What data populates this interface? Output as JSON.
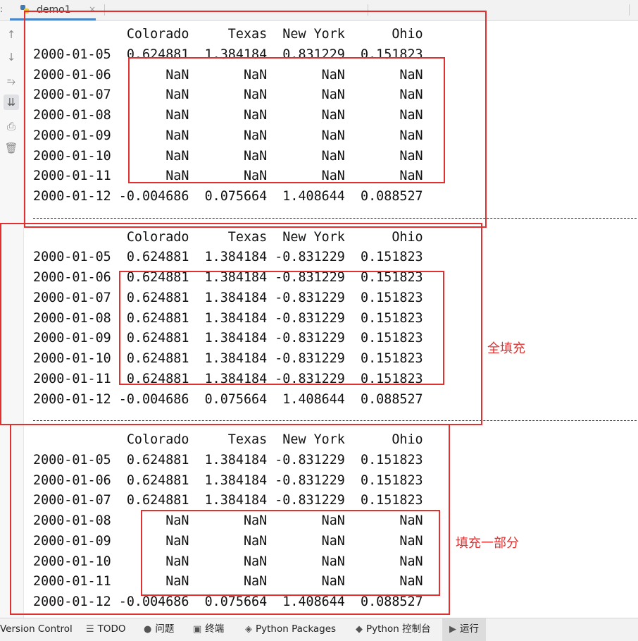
{
  "tab": {
    "file_name": "demo1",
    "close_glyph": "×"
  },
  "left_edge_glyph": ":",
  "gutter_icons": [
    "arrow-up-icon",
    "arrow-down-icon",
    "soft-wrap-icon",
    "scroll-to-end-icon",
    "print-icon",
    "trash-icon"
  ],
  "gutter_glyphs": [
    "↑",
    "↓",
    "⥱",
    "⇊",
    "⎙",
    "🗑"
  ],
  "blocks": [
    {
      "header": "            Colorado     Texas  New York      Ohio",
      "rows": [
        "2000-01-05  0.624881  1.384184  0.831229  0.151823",
        "2000-01-06       NaN       NaN       NaN       NaN",
        "2000-01-07       NaN       NaN       NaN       NaN",
        "2000-01-08       NaN       NaN       NaN       NaN",
        "2000-01-09       NaN       NaN       NaN       NaN",
        "2000-01-10       NaN       NaN       NaN       NaN",
        "2000-01-11       NaN       NaN       NaN       NaN",
        "2000-01-12 -0.004686  0.075664  1.408644  0.088527"
      ]
    },
    {
      "header": "            Colorado     Texas  New York      Ohio",
      "rows": [
        "2000-01-05  0.624881  1.384184 -0.831229  0.151823",
        "2000-01-06  0.624881  1.384184 -0.831229  0.151823",
        "2000-01-07  0.624881  1.384184 -0.831229  0.151823",
        "2000-01-08  0.624881  1.384184 -0.831229  0.151823",
        "2000-01-09  0.624881  1.384184 -0.831229  0.151823",
        "2000-01-10  0.624881  1.384184 -0.831229  0.151823",
        "2000-01-11  0.624881  1.384184 -0.831229  0.151823",
        "2000-01-12 -0.004686  0.075664  1.408644  0.088527"
      ]
    },
    {
      "header": "            Colorado     Texas  New York      Ohio",
      "rows": [
        "2000-01-05  0.624881  1.384184 -0.831229  0.151823",
        "2000-01-06  0.624881  1.384184 -0.831229  0.151823",
        "2000-01-07  0.624881  1.384184 -0.831229  0.151823",
        "2000-01-08       NaN       NaN       NaN       NaN",
        "2000-01-09       NaN       NaN       NaN       NaN",
        "2000-01-10       NaN       NaN       NaN       NaN",
        "2000-01-11       NaN       NaN       NaN       NaN",
        "2000-01-12 -0.004686  0.075664  1.408644  0.088527"
      ]
    }
  ],
  "annotations": {
    "full_fill": "全填充",
    "partial_fill": "填充一部分"
  },
  "bottom_bar": [
    {
      "label": "Version Control",
      "icon": ""
    },
    {
      "label": "TODO",
      "icon": "☰"
    },
    {
      "label": "问题",
      "icon": "●"
    },
    {
      "label": "终端",
      "icon": "▣"
    },
    {
      "label": "Python Packages",
      "icon": "◈"
    },
    {
      "label": "Python 控制台",
      "icon": "◆"
    },
    {
      "label": "运行",
      "icon": "▶"
    }
  ],
  "colors": {
    "annotation_red": "#e03030",
    "tab_underline": "#4a88c7"
  }
}
